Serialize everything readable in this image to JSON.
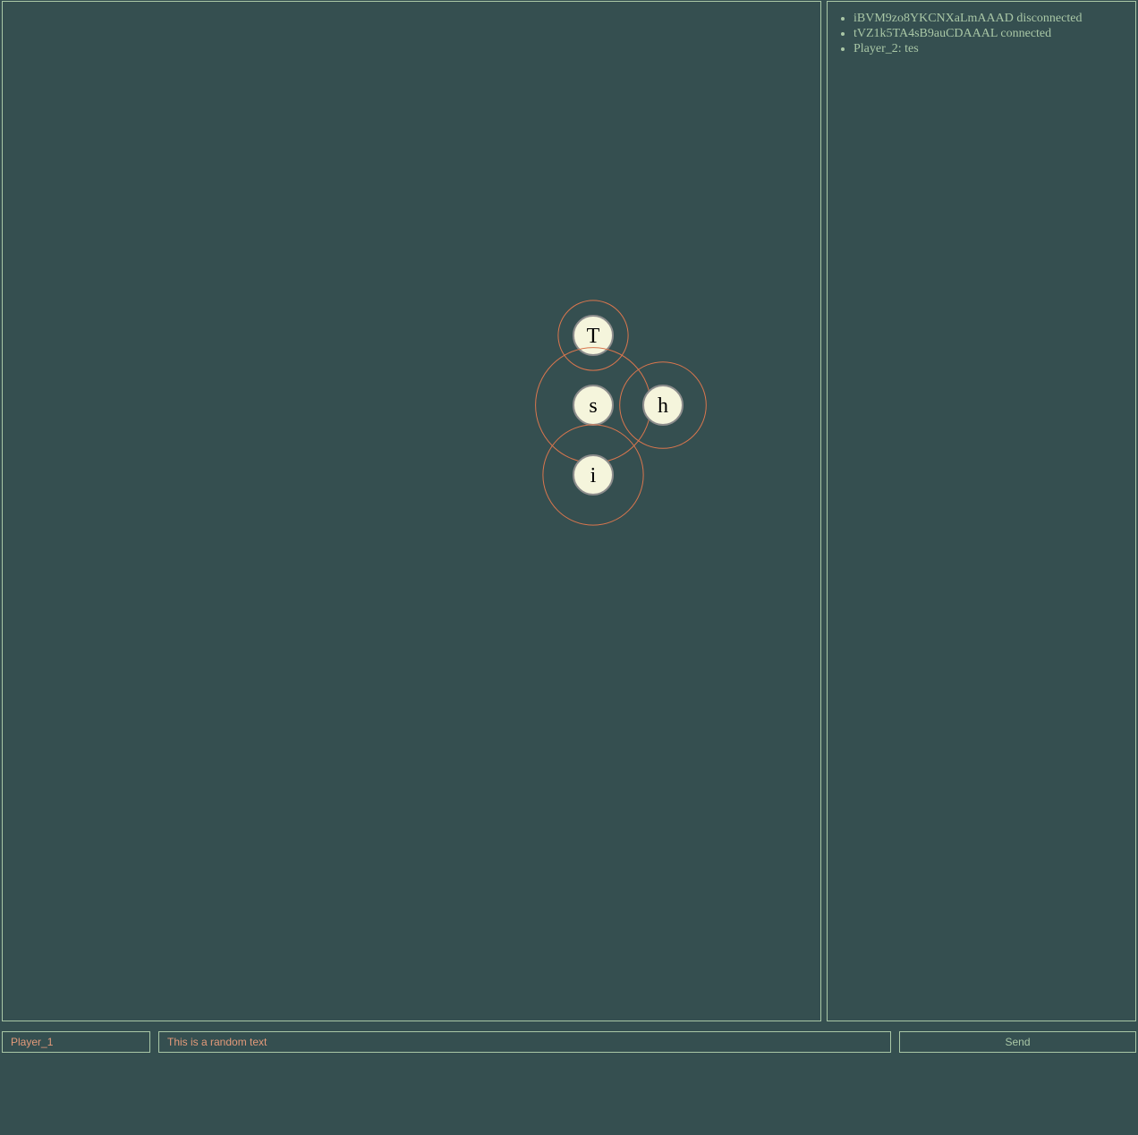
{
  "board": {
    "tiles": [
      {
        "letter": "T",
        "col": 0,
        "row": 0,
        "aura": 0.85
      },
      {
        "letter": "s",
        "col": 0,
        "row": 1,
        "aura": 1.4
      },
      {
        "letter": "h",
        "col": 1,
        "row": 1,
        "aura": 1.05
      },
      {
        "letter": "i",
        "col": 0,
        "row": 2,
        "aura": 1.22
      }
    ]
  },
  "log": {
    "messages": [
      "iBVM9zo8YKCNXaLmAAAD disconnected",
      "tVZ1k5TA4sB9auCDAAAL connected",
      "Player_2: tes"
    ]
  },
  "controls": {
    "name_value": "Player_1",
    "message_value": "This is a random text",
    "send_label": "Send"
  },
  "colors": {
    "background": "#354f50",
    "border": "#a9c7a6",
    "aura": "#d9764e",
    "tile_fill": "#f5f5dc",
    "tile_stroke": "#8c8c8c",
    "input_text": "#e39a7a"
  }
}
